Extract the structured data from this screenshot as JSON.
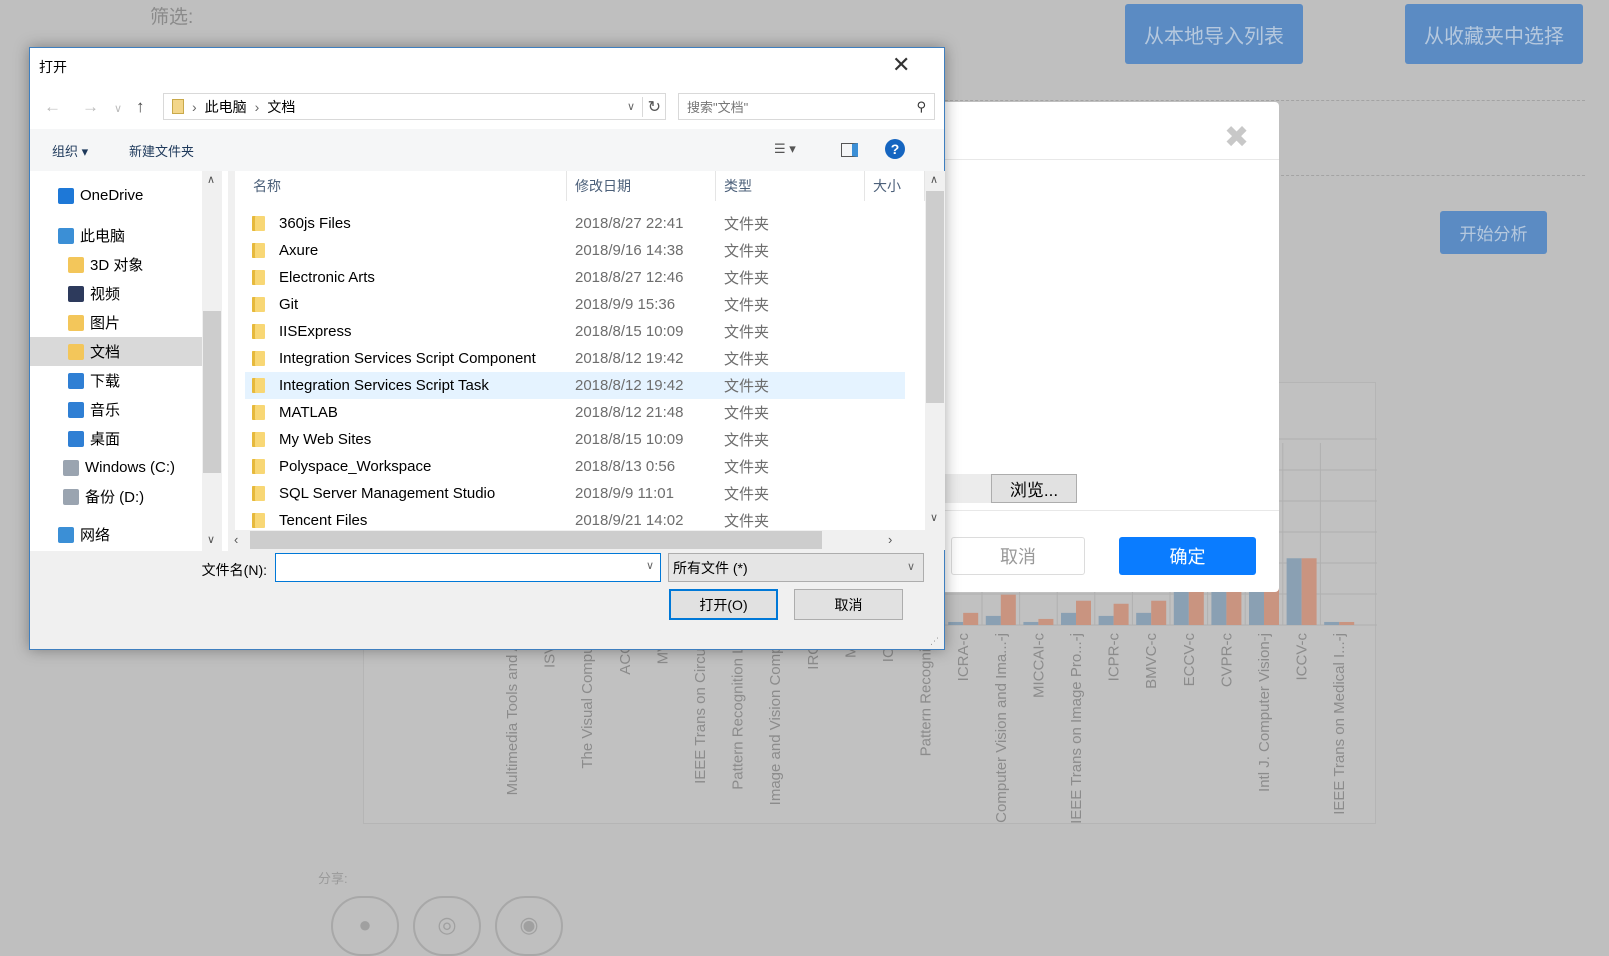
{
  "page": {
    "filter_label": "筛选:",
    "import_local_label": "从本地导入列表",
    "import_favorites_label": "从收藏夹中选择",
    "analyze_label": "开始分析",
    "share_label": "分享:",
    "share_icons": [
      "qq-icon",
      "wechat-icon",
      "weibo-icon"
    ],
    "colors": {
      "button": "#5b8bc3",
      "confirm": "#0a7cff"
    }
  },
  "upload_modal": {
    "close_icon": "close-icon",
    "browse_label": "浏览...",
    "cancel_label": "取消",
    "confirm_label": "确定"
  },
  "chart_data": {
    "type": "bar",
    "categories": [
      "Multimedia Tools and Ap",
      "ISVC",
      "The Visual Compute",
      "ACCV",
      "MVA",
      "IEEE Trans on Circuits",
      "Pattern Recognition Let",
      "Image and Vision Comput",
      "IROS",
      "MM",
      "ICIP",
      "Pattern Recognitio",
      "ICRA-c",
      "Computer Vision and Ima...-j",
      "MICCAI-c",
      "IEEE Trans on Image Pro...-j",
      "ICPR-c",
      "BMVC-c",
      "ECCV-c",
      "CVPR-c",
      "Intl J. Computer Vision-j",
      "ICCV-c",
      "IEEE Trans on Medical I...-j"
    ],
    "series": [
      {
        "color": "#8aa0b3",
        "values": [
          null,
          null,
          null,
          null,
          null,
          null,
          null,
          null,
          null,
          null,
          null,
          null,
          1,
          3,
          1,
          4,
          3,
          4,
          11,
          11,
          11,
          22,
          1
        ]
      },
      {
        "color": "#c99480",
        "values": [
          null,
          null,
          null,
          null,
          null,
          null,
          null,
          null,
          null,
          null,
          null,
          6,
          4,
          10,
          2,
          8,
          7,
          8,
          11,
          11,
          18,
          22,
          1
        ]
      }
    ],
    "ylim": [
      0,
      60
    ],
    "grid": true
  },
  "dialog": {
    "title": "打开",
    "breadcrumb": [
      "此电脑",
      "文档"
    ],
    "search_placeholder": "搜索\"文档\"",
    "organize_label": "组织 ▾",
    "new_folder_label": "新建文件夹",
    "nav": [
      {
        "label": "OneDrive",
        "icon": "onedrive-icon",
        "color": "#1e78d7"
      },
      {
        "label": "此电脑",
        "icon": "this-pc-icon",
        "color": "#3b8fd6"
      },
      {
        "label": "3D 对象",
        "icon": "3d-objects-icon",
        "color": "#f3c65a"
      },
      {
        "label": "视频",
        "icon": "videos-icon",
        "color": "#2d3a5c"
      },
      {
        "label": "图片",
        "icon": "pictures-icon",
        "color": "#f3c65a"
      },
      {
        "label": "文档",
        "icon": "documents-icon",
        "color": "#f3c65a",
        "selected": true
      },
      {
        "label": "下载",
        "icon": "downloads-icon",
        "color": "#2f7fd4"
      },
      {
        "label": "音乐",
        "icon": "music-icon",
        "color": "#2f7fd4"
      },
      {
        "label": "桌面",
        "icon": "desktop-icon",
        "color": "#2f7fd4"
      },
      {
        "label": "Windows (C:)",
        "icon": "drive-c-icon",
        "color": "#9aa4b0"
      },
      {
        "label": "备份 (D:)",
        "icon": "drive-d-icon",
        "color": "#9aa4b0"
      },
      {
        "label": "网络",
        "icon": "network-icon",
        "color": "#3b8fd6"
      }
    ],
    "columns": [
      "名称",
      "修改日期",
      "类型",
      "大小"
    ],
    "files": [
      {
        "name": "360js Files",
        "date": "2018/8/27 22:41",
        "type": "文件夹"
      },
      {
        "name": "Axure",
        "date": "2018/9/16 14:38",
        "type": "文件夹"
      },
      {
        "name": "Electronic Arts",
        "date": "2018/8/27 12:46",
        "type": "文件夹"
      },
      {
        "name": "Git",
        "date": "2018/9/9 15:36",
        "type": "文件夹"
      },
      {
        "name": "IISExpress",
        "date": "2018/8/15 10:09",
        "type": "文件夹"
      },
      {
        "name": "Integration Services Script Component",
        "date": "2018/8/12 19:42",
        "type": "文件夹"
      },
      {
        "name": "Integration Services Script Task",
        "date": "2018/8/12 19:42",
        "type": "文件夹",
        "hover": true
      },
      {
        "name": "MATLAB",
        "date": "2018/8/12 21:48",
        "type": "文件夹"
      },
      {
        "name": "My Web Sites",
        "date": "2018/8/15 10:09",
        "type": "文件夹"
      },
      {
        "name": "Polyspace_Workspace",
        "date": "2018/8/13 0:56",
        "type": "文件夹"
      },
      {
        "name": "SQL Server Management Studio",
        "date": "2018/9/9 11:01",
        "type": "文件夹"
      },
      {
        "name": "Tencent Files",
        "date": "2018/9/21 14:02",
        "type": "文件夹"
      }
    ],
    "filename_label": "文件名(N):",
    "filename_value": "",
    "filetype_selected": "所有文件 (*)",
    "open_label": "打开(O)",
    "cancel_label": "取消"
  }
}
